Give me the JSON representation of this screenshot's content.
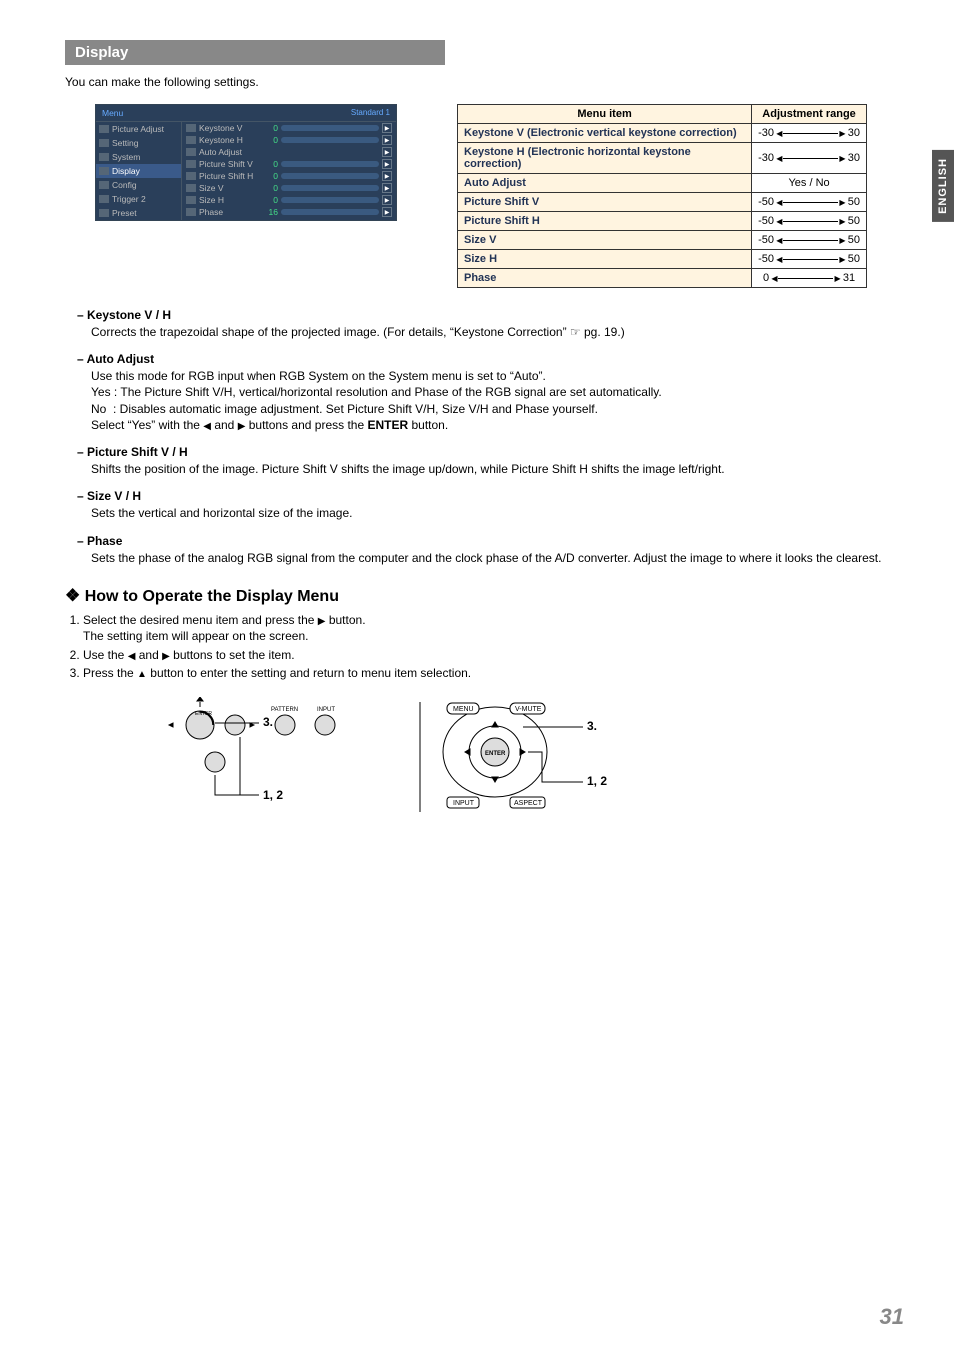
{
  "lang_tab": "ENGLISH",
  "section_header": "Display",
  "intro": "You can make the following settings.",
  "osd": {
    "menu": "Menu",
    "standard": "Standard 1",
    "left_items": [
      "Picture Adjust",
      "Setting",
      "System",
      "Display",
      "Config",
      "Trigger 2",
      "Preset"
    ],
    "selected_index": 3,
    "rows": [
      {
        "label": "Keystone V",
        "val": "0",
        "bar": true
      },
      {
        "label": "Keystone H",
        "val": "0",
        "bar": true
      },
      {
        "label": "Auto Adjust",
        "val": "",
        "bar": false
      },
      {
        "label": "Picture Shift V",
        "val": "0",
        "bar": true
      },
      {
        "label": "Picture Shift H",
        "val": "0",
        "bar": true
      },
      {
        "label": "Size V",
        "val": "0",
        "bar": true
      },
      {
        "label": "Size H",
        "val": "0",
        "bar": true
      },
      {
        "label": "Phase",
        "val": "16",
        "bar": true
      }
    ]
  },
  "range_table": {
    "header_item": "Menu item",
    "header_range": "Adjustment range",
    "rows": [
      {
        "label": "Keystone V (Electronic vertical keystone correction)",
        "lo": "-30",
        "hi": "30",
        "type": "range"
      },
      {
        "label": "Keystone H (Electronic horizontal keystone correction)",
        "lo": "-30",
        "hi": "30",
        "type": "range"
      },
      {
        "label": "Auto Adjust",
        "text": "Yes / No",
        "type": "text"
      },
      {
        "label": "Picture Shift V",
        "lo": "-50",
        "hi": "50",
        "type": "range"
      },
      {
        "label": "Picture Shift H",
        "lo": "-50",
        "hi": "50",
        "type": "range"
      },
      {
        "label": "Size V",
        "lo": "-50",
        "hi": "50",
        "type": "range"
      },
      {
        "label": "Size H",
        "lo": "-50",
        "hi": "50",
        "type": "range"
      },
      {
        "label": "Phase",
        "lo": "0",
        "hi": "31",
        "type": "range"
      }
    ]
  },
  "desc": {
    "keystone": {
      "title": "– Keystone V / H",
      "body": "Corrects the trapezoidal shape of the projected image. (For details, “Keystone Correction” ☞ pg. 19.)"
    },
    "auto_adjust": {
      "title": "– Auto Adjust",
      "line1": "Use this mode for RGB input when RGB System on the System menu is set to “Auto”.",
      "line2": "Yes : The Picture Shift V/H, vertical/horizontal resolution and Phase of the RGB signal are set automatically.",
      "line3": "No  : Disables automatic image adjustment. Set Picture Shift V/H, Size V/H and Phase yourself.",
      "line4a": " Select “Yes” with the ",
      "line4b": " and ",
      "line4c": " buttons and press the ",
      "line4d": " button.",
      "enter": "ENTER"
    },
    "picture_shift": {
      "title": "– Picture Shift V / H",
      "body": "Shifts the position of the image. Picture Shift V shifts the image up/down, while Picture Shift H shifts the image left/right."
    },
    "size": {
      "title": "– Size V / H",
      "body": "Sets the vertical and horizontal size of the image."
    },
    "phase": {
      "title": "– Phase",
      "body": "Sets the phase of the analog RGB signal from the computer and the clock phase of the A/D converter. Adjust the image to where it looks the clearest."
    }
  },
  "howto": {
    "title": "How to Operate the Display Menu",
    "steps": [
      {
        "a": "Select the desired menu item and press the ",
        "b": " button.",
        "sub": "The setting item will appear on the screen."
      },
      {
        "a": "Use the ",
        "mid": " and ",
        "b": " buttons to set the item."
      },
      {
        "a": "Press the ",
        "b": " button to enter the setting and return to menu item selection."
      }
    ]
  },
  "fig_labels": {
    "enter": "ENTER",
    "pattern": "PATTERN",
    "input": "INPUT",
    "menu": "MENU",
    "vmute": "V-MUTE",
    "aspect": "ASPECT",
    "mark3": "3.",
    "mark12": "1, 2"
  },
  "page_number": "31"
}
